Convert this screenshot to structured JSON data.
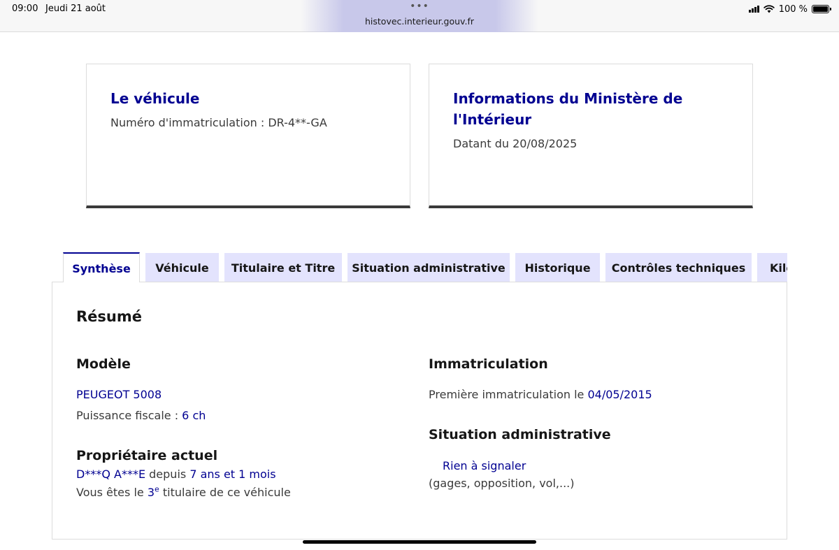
{
  "status_bar": {
    "time": "09:00",
    "date": "Jeudi 21 août",
    "url": "histovec.interieur.gouv.fr",
    "more": "•••",
    "battery": "100 %",
    "icons": [
      "signal-icon",
      "wifi-icon",
      "battery-icon"
    ]
  },
  "cards": {
    "vehicle": {
      "title": "Le véhicule",
      "subtitle": "Numéro d'immatriculation : DR-4**-GA"
    },
    "ministry": {
      "title": "Informations du Ministère de l'Intérieur",
      "subtitle": "Datant du 20/08/2025"
    }
  },
  "tabs": [
    {
      "label": "Synthèse",
      "active": true
    },
    {
      "label": "Véhicule"
    },
    {
      "label": "Titulaire et Titre"
    },
    {
      "label": "Situation administrative"
    },
    {
      "label": "Historique"
    },
    {
      "label": "Contrôles techniques"
    },
    {
      "label": "Kilométrage"
    }
  ],
  "summary": {
    "heading": "Résumé",
    "model": {
      "heading": "Modèle",
      "name": "PEUGEOT 5008",
      "power_label": "Puissance fiscale : ",
      "power_value": "6 ch"
    },
    "owner": {
      "heading": "Propriétaire actuel",
      "name": "D***Q A***E",
      "since_label": " depuis ",
      "duration": "7 ans et 1 mois",
      "rank_prefix": "Vous êtes le ",
      "rank_number": "3",
      "rank_sup": "e",
      "rank_suffix": " titulaire de ce véhicule"
    },
    "registration": {
      "heading": "Immatriculation",
      "first_label": "Première immatriculation le ",
      "first_date": "04/05/2015"
    },
    "admin": {
      "heading": "Situation administrative",
      "status": "Rien à signaler",
      "note": "(gages, opposition, vol,...)"
    }
  },
  "colors": {
    "accent": "#000091",
    "tab_bg": "#e3e3fd",
    "text": "#3a3a3a",
    "border": "#dcdcdc"
  }
}
